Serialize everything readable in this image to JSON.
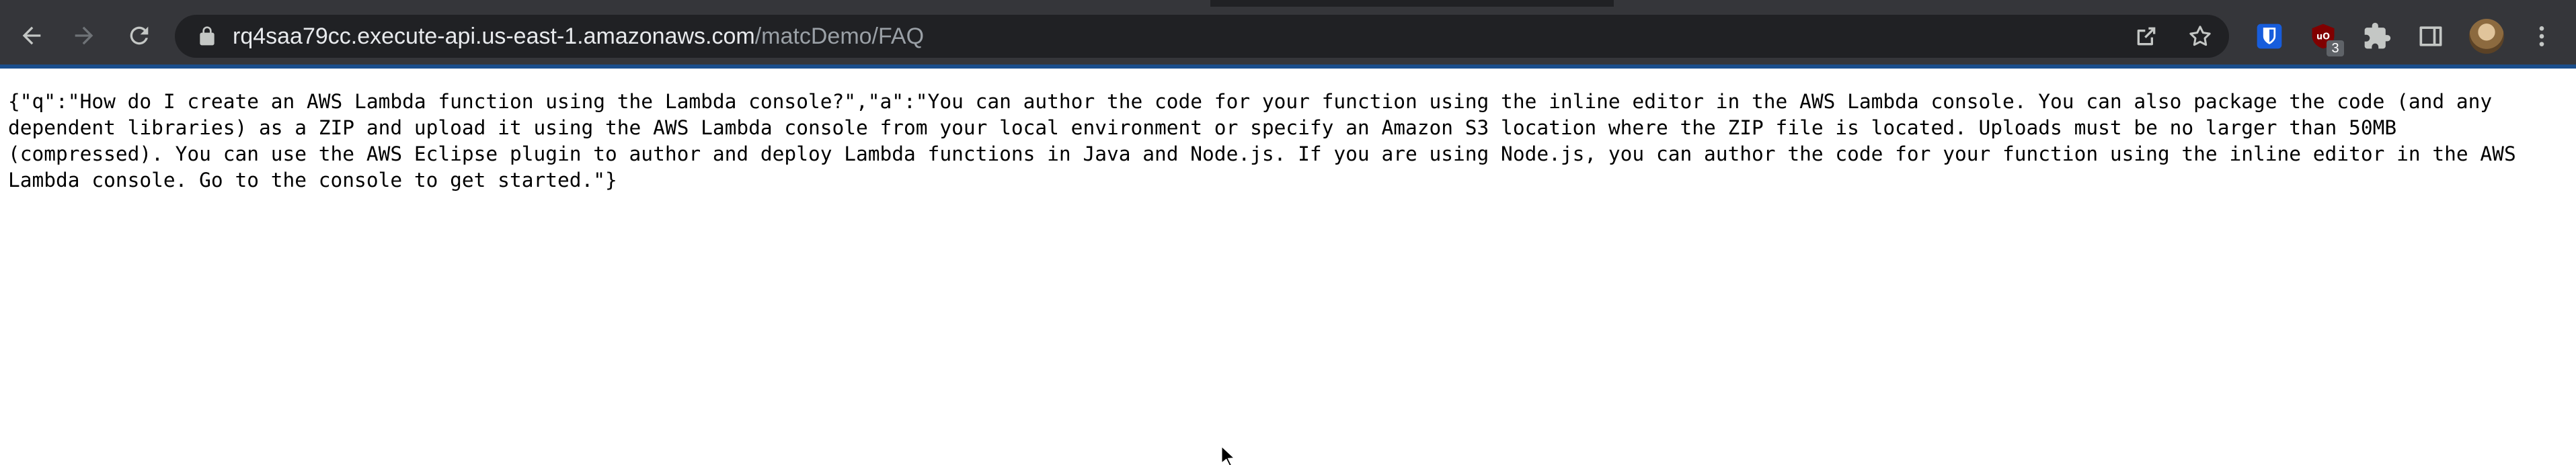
{
  "browser": {
    "url_host": "rq4saa79cc.execute-api.us-east-1.amazonaws.com",
    "url_path": "/matcDemo/FAQ",
    "extension_badge": "3",
    "icons": {
      "back": "back-arrow-icon",
      "forward": "forward-arrow-icon",
      "reload": "reload-icon",
      "lock": "lock-icon",
      "share": "share-icon",
      "bookmark": "star-icon",
      "bitwarden": "bitwarden-shield-icon",
      "ublock": "ublock-origin-icon",
      "extensions": "puzzle-piece-icon",
      "side_panel": "side-panel-icon",
      "avatar": "profile-avatar",
      "menu": "kebab-menu-icon"
    },
    "colors": {
      "toolbar": "#35363a",
      "omnibox": "#202124",
      "accent_line": "#1a4e8c",
      "bitwarden": "#175ddc",
      "ublock": "#800000"
    }
  },
  "page": {
    "json_text": "{\"q\":\"How do I create an AWS Lambda function using the Lambda console?\",\"a\":\"You can author the code for your function using the inline editor in the AWS Lambda console. You can also package the code (and any dependent libraries) as a ZIP and upload it using the AWS Lambda console from your local environment or specify an Amazon S3 location where the ZIP file is located. Uploads must be no larger than 50MB (compressed). You can use the AWS Eclipse plugin to author and deploy Lambda functions in Java and Node.js. If you are using Node.js, you can author the code for your function using the inline editor in the AWS Lambda console. Go to the console to get started.\"}"
  }
}
